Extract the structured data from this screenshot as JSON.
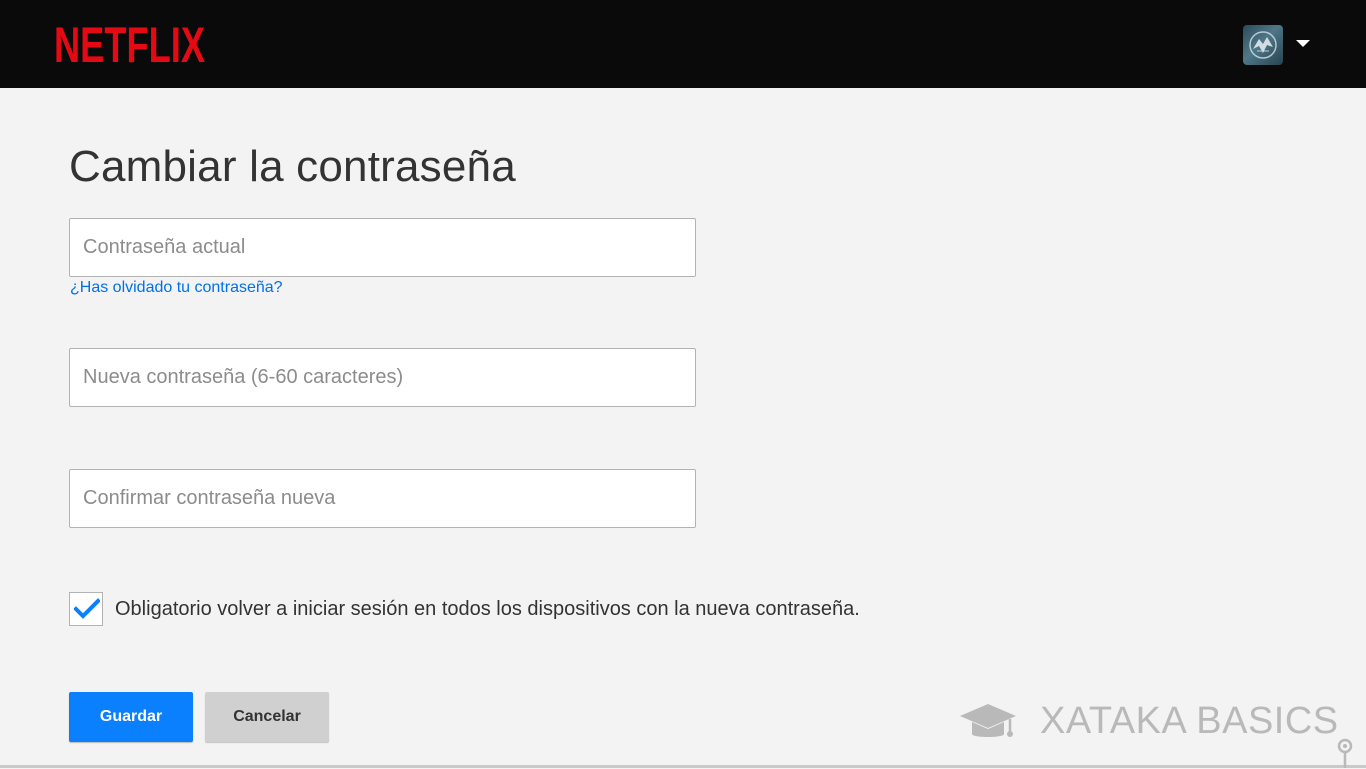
{
  "header": {
    "logo_text": "NETFLIX",
    "brand_color": "#e50914",
    "avatar_icon": "profile-avatar",
    "menu_icon": "caret-down"
  },
  "form": {
    "title": "Cambiar la contraseña",
    "current_password": {
      "placeholder": "Contraseña actual",
      "value": ""
    },
    "forgot_link": "¿Has olvidado tu contraseña?",
    "new_password": {
      "placeholder": "Nueva contraseña (6-60 caracteres)",
      "value": ""
    },
    "confirm_password": {
      "placeholder": "Confirmar contraseña nueva",
      "value": ""
    },
    "signout_checkbox": {
      "label": "Obligatorio volver a iniciar sesión en todos los dispositivos con la nueva contraseña.",
      "checked": true
    },
    "save_label": "Guardar",
    "cancel_label": "Cancelar"
  },
  "colors": {
    "accent": "#0a80ff",
    "link": "#0071eb",
    "background": "#f3f3f3",
    "header_bg": "#0a0a0a"
  },
  "watermark": {
    "text": "XATAKA BASICS",
    "icon": "graduation-cap-icon"
  }
}
